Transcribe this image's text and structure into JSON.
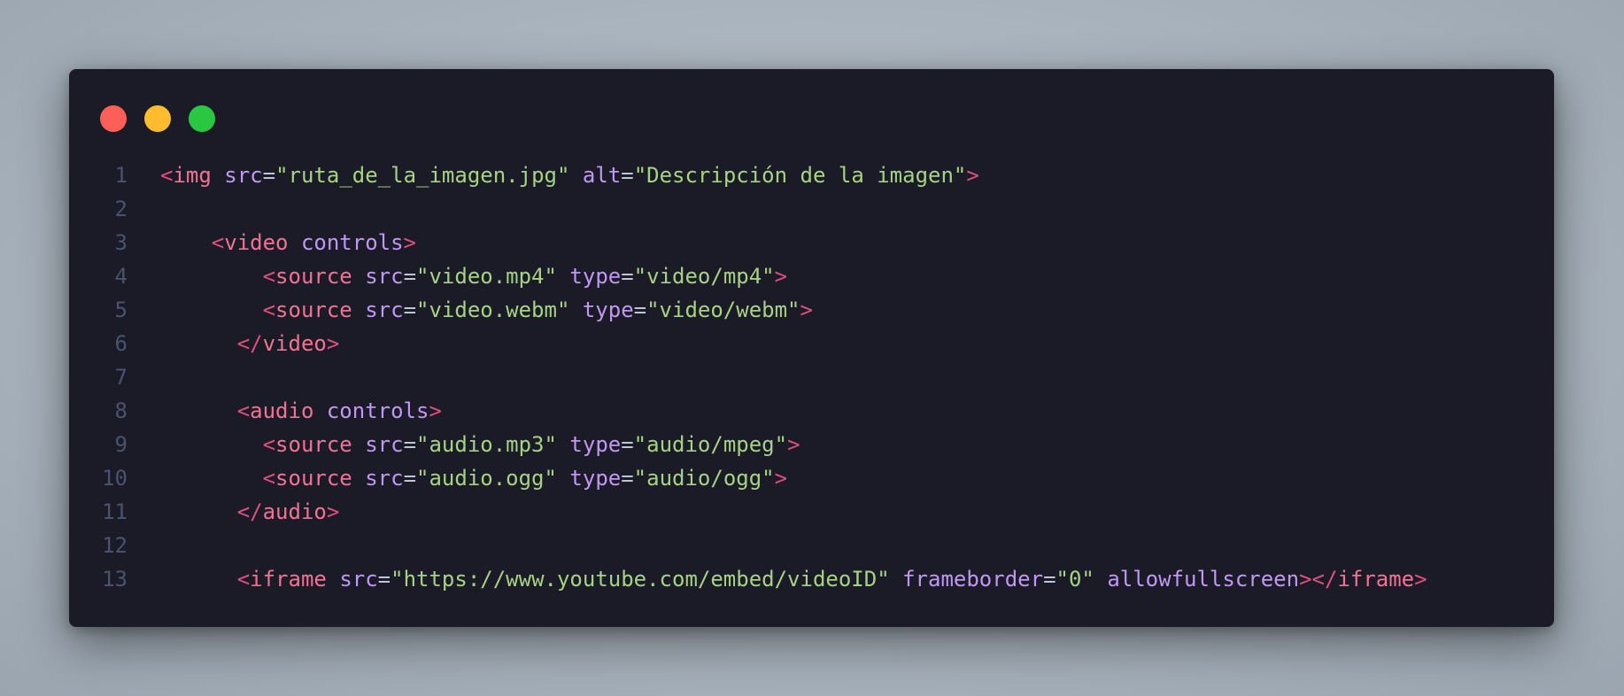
{
  "window_controls": [
    "close",
    "minimize",
    "maximize"
  ],
  "colors": {
    "close": "#ff5f57",
    "minimize": "#febc2e",
    "maximize": "#28c840",
    "editor_background": "#1b1b28",
    "tag": "#f27292",
    "bracket": "#e24f7c",
    "attribute": "#c097f3",
    "string": "#a6d382",
    "line_number": "#4b5270"
  },
  "lines": [
    {
      "num": "1",
      "indent": "",
      "tokens": [
        {
          "t": "br",
          "v": "<"
        },
        {
          "t": "tag",
          "v": "img"
        },
        {
          "t": "sp",
          "v": " "
        },
        {
          "t": "attr",
          "v": "src"
        },
        {
          "t": "eq",
          "v": "="
        },
        {
          "t": "str",
          "v": "\"ruta_de_la_imagen.jpg\""
        },
        {
          "t": "sp",
          "v": " "
        },
        {
          "t": "attr",
          "v": "alt"
        },
        {
          "t": "eq",
          "v": "="
        },
        {
          "t": "str",
          "v": "\"Descripción de la imagen\""
        },
        {
          "t": "br",
          "v": ">"
        }
      ]
    },
    {
      "num": "2",
      "indent": "",
      "tokens": []
    },
    {
      "num": "3",
      "indent": "    ",
      "tokens": [
        {
          "t": "br",
          "v": "<"
        },
        {
          "t": "tag",
          "v": "video"
        },
        {
          "t": "sp",
          "v": " "
        },
        {
          "t": "attr",
          "v": "controls"
        },
        {
          "t": "br",
          "v": ">"
        }
      ]
    },
    {
      "num": "4",
      "indent": "        ",
      "tokens": [
        {
          "t": "br",
          "v": "<"
        },
        {
          "t": "tag",
          "v": "source"
        },
        {
          "t": "sp",
          "v": " "
        },
        {
          "t": "attr",
          "v": "src"
        },
        {
          "t": "eq",
          "v": "="
        },
        {
          "t": "str",
          "v": "\"video.mp4\""
        },
        {
          "t": "sp",
          "v": " "
        },
        {
          "t": "attr",
          "v": "type"
        },
        {
          "t": "eq",
          "v": "="
        },
        {
          "t": "str",
          "v": "\"video/mp4\""
        },
        {
          "t": "br",
          "v": ">"
        }
      ]
    },
    {
      "num": "5",
      "indent": "        ",
      "tokens": [
        {
          "t": "br",
          "v": "<"
        },
        {
          "t": "tag",
          "v": "source"
        },
        {
          "t": "sp",
          "v": " "
        },
        {
          "t": "attr",
          "v": "src"
        },
        {
          "t": "eq",
          "v": "="
        },
        {
          "t": "str",
          "v": "\"video.webm\""
        },
        {
          "t": "sp",
          "v": " "
        },
        {
          "t": "attr",
          "v": "type"
        },
        {
          "t": "eq",
          "v": "="
        },
        {
          "t": "str",
          "v": "\"video/webm\""
        },
        {
          "t": "br",
          "v": ">"
        }
      ]
    },
    {
      "num": "6",
      "indent": "      ",
      "tokens": [
        {
          "t": "br",
          "v": "</"
        },
        {
          "t": "tag",
          "v": "video"
        },
        {
          "t": "br",
          "v": ">"
        }
      ]
    },
    {
      "num": "7",
      "indent": "",
      "tokens": []
    },
    {
      "num": "8",
      "indent": "      ",
      "tokens": [
        {
          "t": "br",
          "v": "<"
        },
        {
          "t": "tag",
          "v": "audio"
        },
        {
          "t": "sp",
          "v": " "
        },
        {
          "t": "attr",
          "v": "controls"
        },
        {
          "t": "br",
          "v": ">"
        }
      ]
    },
    {
      "num": "9",
      "indent": "        ",
      "tokens": [
        {
          "t": "br",
          "v": "<"
        },
        {
          "t": "tag",
          "v": "source"
        },
        {
          "t": "sp",
          "v": " "
        },
        {
          "t": "attr",
          "v": "src"
        },
        {
          "t": "eq",
          "v": "="
        },
        {
          "t": "str",
          "v": "\"audio.mp3\""
        },
        {
          "t": "sp",
          "v": " "
        },
        {
          "t": "attr",
          "v": "type"
        },
        {
          "t": "eq",
          "v": "="
        },
        {
          "t": "str",
          "v": "\"audio/mpeg\""
        },
        {
          "t": "br",
          "v": ">"
        }
      ]
    },
    {
      "num": "10",
      "indent": "        ",
      "tokens": [
        {
          "t": "br",
          "v": "<"
        },
        {
          "t": "tag",
          "v": "source"
        },
        {
          "t": "sp",
          "v": " "
        },
        {
          "t": "attr",
          "v": "src"
        },
        {
          "t": "eq",
          "v": "="
        },
        {
          "t": "str",
          "v": "\"audio.ogg\""
        },
        {
          "t": "sp",
          "v": " "
        },
        {
          "t": "attr",
          "v": "type"
        },
        {
          "t": "eq",
          "v": "="
        },
        {
          "t": "str",
          "v": "\"audio/ogg\""
        },
        {
          "t": "br",
          "v": ">"
        }
      ]
    },
    {
      "num": "11",
      "indent": "      ",
      "tokens": [
        {
          "t": "br",
          "v": "</"
        },
        {
          "t": "tag",
          "v": "audio"
        },
        {
          "t": "br",
          "v": ">"
        }
      ]
    },
    {
      "num": "12",
      "indent": "",
      "tokens": []
    },
    {
      "num": "13",
      "indent": "      ",
      "tokens": [
        {
          "t": "br",
          "v": "<"
        },
        {
          "t": "tag",
          "v": "iframe"
        },
        {
          "t": "sp",
          "v": " "
        },
        {
          "t": "attr",
          "v": "src"
        },
        {
          "t": "eq",
          "v": "="
        },
        {
          "t": "str",
          "v": "\"https://www.youtube.com/embed/videoID\""
        },
        {
          "t": "sp",
          "v": " "
        },
        {
          "t": "attr",
          "v": "frameborder"
        },
        {
          "t": "eq",
          "v": "="
        },
        {
          "t": "str",
          "v": "\"0\""
        },
        {
          "t": "sp",
          "v": " "
        },
        {
          "t": "attr",
          "v": "allowfullscreen"
        },
        {
          "t": "br",
          "v": "></"
        },
        {
          "t": "tag",
          "v": "iframe"
        },
        {
          "t": "br",
          "v": ">"
        }
      ]
    }
  ]
}
